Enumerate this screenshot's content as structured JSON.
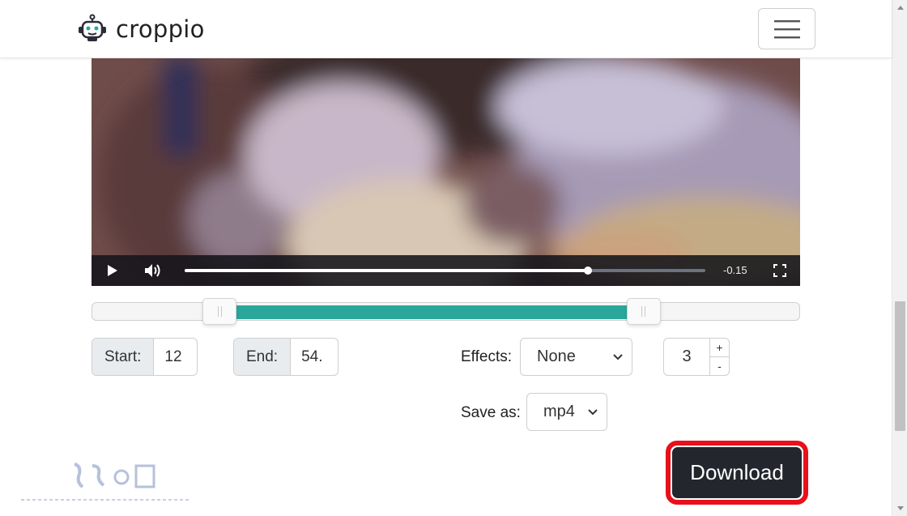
{
  "app": {
    "brand": "croppio"
  },
  "player": {
    "time_remaining": "-0.15",
    "progress": 0.775
  },
  "trim": {
    "start_label": "Start:",
    "start_value": "12",
    "end_label": "End:",
    "end_value": "54.",
    "selection_start_fraction": 0.18,
    "selection_end_fraction": 0.78
  },
  "effects": {
    "label": "Effects:",
    "selected": "None"
  },
  "stepper": {
    "value": "3",
    "plus": "+",
    "minus": "-"
  },
  "save_as": {
    "label": "Save as:",
    "selected": "mp4"
  },
  "download": {
    "label": "Download"
  },
  "colors": {
    "accent": "#2aa79b",
    "dark_button": "#24262e",
    "highlight": "#e8101a"
  },
  "icons": [
    "robot-logo-icon",
    "hamburger-menu-icon",
    "play-icon",
    "volume-icon",
    "fullscreen-icon",
    "chevron-down-icon"
  ]
}
